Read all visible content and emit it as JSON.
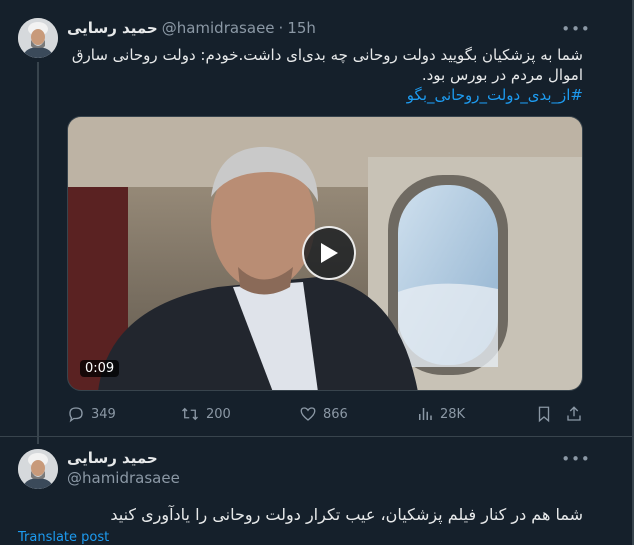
{
  "colors": {
    "background": "#15202b",
    "text": "#e7e9ea",
    "muted": "#8b98a5",
    "link": "#1d9bf0",
    "border": "#38444d"
  },
  "tweet": {
    "author_name": "حمید رسایی",
    "handle": "@hamidrasaee",
    "separator": "·",
    "time": "15h",
    "text_lines": [
      "شما به پزشکیان بگویید دولت روحانی چه بدی‌ای داشت.خودم: دولت روحانی سارق",
      "اموال مردم در بورس بود."
    ],
    "hashtag": "#از_بدی_دولت_روحانی_بگو",
    "video": {
      "duration": "0:09",
      "icon": "play-icon"
    },
    "actions": {
      "replies": "349",
      "reposts": "200",
      "likes": "866",
      "views": "28K",
      "icons": [
        "reply-icon",
        "repost-icon",
        "like-icon",
        "views-icon",
        "bookmark-icon",
        "share-icon"
      ]
    }
  },
  "reply": {
    "author_name": "حمید رسایی",
    "handle": "@hamidrasaee",
    "text": "شما هم در کنار فیلم پزشکیان، عیب تکرار دولت روحانی را یادآوری کنید",
    "translate_label": "Translate post"
  }
}
